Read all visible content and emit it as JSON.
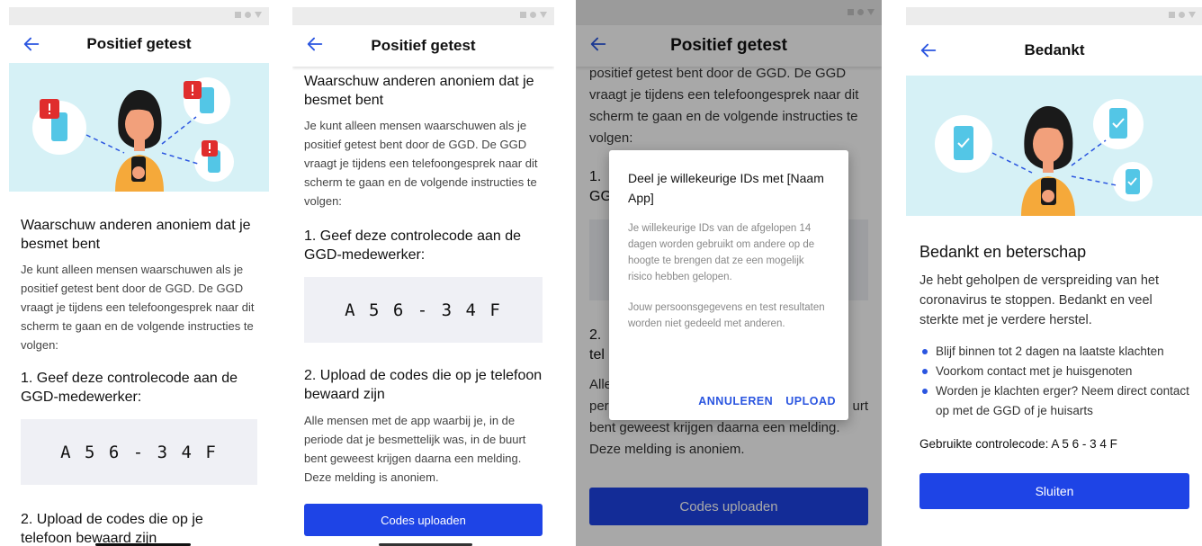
{
  "colors": {
    "accent": "#1e44e6",
    "hero_bg": "#d6f1f6",
    "alert": "#e02d2d",
    "phone_device": "#53c6e6",
    "code_bg": "#eff0f5"
  },
  "screens": {
    "s1": {
      "title": "Positief getest",
      "section_title": "Waarschuw anderen anoniem dat je besmet bent",
      "intro": "Je kunt alleen mensen waarschuwen als je positief getest bent door de GGD. De GGD vraagt je tijdens een telefoongesprek naar dit scherm te gaan en de volgende instructies te volgen:",
      "step1": "1. Geef deze controlecode aan de GGD-medewerker:",
      "code": "A 5 6 - 3 4 F",
      "step2": "2. Upload de codes die op je telefoon bewaard zijn"
    },
    "s2": {
      "title": "Positief getest",
      "section_title": "Waarschuw anderen anoniem dat je besmet bent",
      "intro": "Je kunt alleen mensen waarschuwen als je positief getest bent door de GGD. De GGD vraagt je tijdens een telefoongesprek naar dit scherm te gaan en de volgende instructies te volgen:",
      "step1": "1. Geef deze controlecode aan de GGD-medewerker:",
      "code": "A 5 6 - 3 4 F",
      "step2": "2. Upload de codes die op je telefoon bewaard zijn",
      "step2_text": "Alle mensen met de app waarbij je, in de periode dat je besmettelijk was, in de buurt bent geweest krijgen daarna een melding. Deze melding is anoniem.",
      "upload_button": "Codes uploaden"
    },
    "s3": {
      "title": "Positief getest",
      "partial_intro": "positief getest bent door de GGD. De GGD vraagt je tijdens een telefoongesprek naar dit scherm te gaan en de volgende instructies te volgen:",
      "step1_peek": "1.",
      "step1_peek2": "GG",
      "step2_peek": "2.",
      "step2_peek2": "tel",
      "peek_alle": "Alle",
      "peek_per": "per",
      "peek_urt": "urt",
      "tail_text": "bent geweest krijgen daarna een melding. Deze melding is anoniem.",
      "upload_button": "Codes uploaden",
      "dialog": {
        "title": "Deel je willekeurige IDs met [Naam App]",
        "text1": "Je willekeurige IDs van de afgelopen 14 dagen worden gebruikt om andere op de hoogte te brengen dat ze een mogelijk risico hebben gelopen.",
        "text2": "Jouw persoonsgegevens en test resultaten worden niet gedeeld met anderen.",
        "cancel": "ANNULEREN",
        "confirm": "UPLOAD"
      }
    },
    "s4": {
      "title": "Bedankt",
      "heading": "Bedankt en beterschap",
      "intro": "Je hebt geholpen de verspreiding van het coronavirus te stoppen. Bedankt en veel sterkte met je verdere herstel.",
      "tips": [
        "Blijf binnen tot 2 dagen na laatste klachten",
        "Voorkom contact met je huisgenoten",
        "Worden je klachten erger? Neem direct contact op met de GGD of je huisarts"
      ],
      "code_label": "Gebruikte controlecode: A 5 6 - 3 4 F",
      "close_button": "Sluiten"
    }
  }
}
